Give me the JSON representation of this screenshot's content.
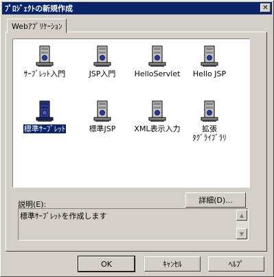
{
  "window": {
    "title": "ﾌﾟﾛｼﾞｪｸﾄの新規作成",
    "close_label": "✕"
  },
  "tab": {
    "label": "Webｱﾌﾟﾘｹｰｼｮﾝ"
  },
  "items": [
    {
      "label": "ｻｰﾌﾞﾚｯﾄ入門",
      "icon": "server-icon",
      "selected": false
    },
    {
      "label": "JSP入門",
      "icon": "server-icon",
      "selected": false
    },
    {
      "label": "HelloServlet",
      "icon": "server-icon",
      "selected": false
    },
    {
      "label": "Hello JSP",
      "icon": "server-icon",
      "selected": false
    },
    {
      "label": "標準ｻｰﾌﾞﾚｯﾄ",
      "icon": "server-icon",
      "selected": true
    },
    {
      "label": "標準JSP",
      "icon": "server-icon",
      "selected": false
    },
    {
      "label": "XML表示入力",
      "icon": "server-icon",
      "selected": false
    },
    {
      "label": "拡張\nﾀｸﾞﾗｲﾌﾞﾗﾘ",
      "icon": "server-icon",
      "selected": false
    }
  ],
  "description": {
    "label": "説明(E):",
    "text": "標準ｻｰﾌﾞﾚｯﾄを作成します",
    "details_button": "詳細(D)..."
  },
  "buttons": {
    "ok": "OK",
    "cancel": "ｷｬﾝｾﾙ",
    "help": "ﾍﾙﾌﾟ"
  },
  "colors": {
    "titlebar": "#0a246a",
    "face": "#d4d0c8",
    "selection": "#0a246a"
  }
}
